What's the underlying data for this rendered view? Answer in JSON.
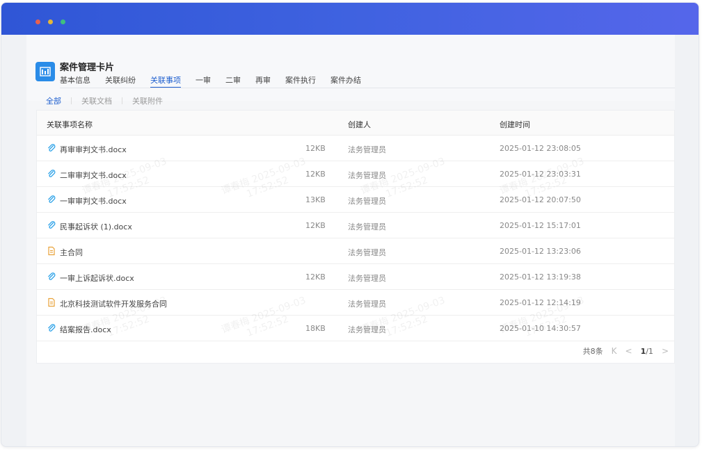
{
  "card": {
    "title": "案件管理卡片",
    "tabs": [
      {
        "label": "基本信息"
      },
      {
        "label": "关联纠纷"
      },
      {
        "label": "关联事项"
      },
      {
        "label": "一审"
      },
      {
        "label": "二审"
      },
      {
        "label": "再审"
      },
      {
        "label": "案件执行"
      },
      {
        "label": "案件办结"
      }
    ],
    "active_tab": "关联事项",
    "subtabs": [
      {
        "label": "全部"
      },
      {
        "label": "关联文档"
      },
      {
        "label": "关联附件"
      }
    ],
    "active_subtab": "全部"
  },
  "table": {
    "columns": {
      "name": "关联事项名称",
      "creator": "创建人",
      "time": "创建时间"
    },
    "rows": [
      {
        "icon": "paperclip-icon",
        "name": "再审审判文书.docx",
        "size": "12KB",
        "creator": "法务管理员",
        "time": "2025-01-12 23:08:05"
      },
      {
        "icon": "paperclip-icon",
        "name": "二审审判文书.docx",
        "size": "12KB",
        "creator": "法务管理员",
        "time": "2025-01-12 23:03:31"
      },
      {
        "icon": "paperclip-icon",
        "name": "一审审判文书.docx",
        "size": "13KB",
        "creator": "法务管理员",
        "time": "2025-01-12 20:07:50"
      },
      {
        "icon": "paperclip-icon",
        "name": "民事起诉状 (1).docx",
        "size": "12KB",
        "creator": "法务管理员",
        "time": "2025-01-12 15:17:01"
      },
      {
        "icon": "document-icon",
        "name": "主合同",
        "size": "",
        "creator": "法务管理员",
        "time": "2025-01-12 13:23:06"
      },
      {
        "icon": "paperclip-icon",
        "name": "一审上诉起诉状.docx",
        "size": "12KB",
        "creator": "法务管理员",
        "time": "2025-01-12 13:19:38"
      },
      {
        "icon": "document-icon",
        "name": "北京科技测试软件开发服务合同",
        "size": "",
        "creator": "法务管理员",
        "time": "2025-01-12 12:14:19"
      },
      {
        "icon": "paperclip-icon",
        "name": "结案报告.docx",
        "size": "18KB",
        "creator": "法务管理员",
        "time": "2025-01-10 14:30:57"
      }
    ]
  },
  "pagination": {
    "total": "共8条",
    "first": "K",
    "prev": "<",
    "current": "1",
    "pages": "/1",
    "next": ">"
  },
  "watermark": {
    "name": "谭春梅",
    "date": "2025-09-03",
    "time": "17:52:52"
  },
  "colors": {
    "accent": "#1f5fcf",
    "titlebar_start": "#2f56d6",
    "titlebar_end": "#5566ea",
    "app_icon": "#2a8ce8",
    "doc_icon": "#e8a23a",
    "clip_icon": "#2aa1e8"
  }
}
